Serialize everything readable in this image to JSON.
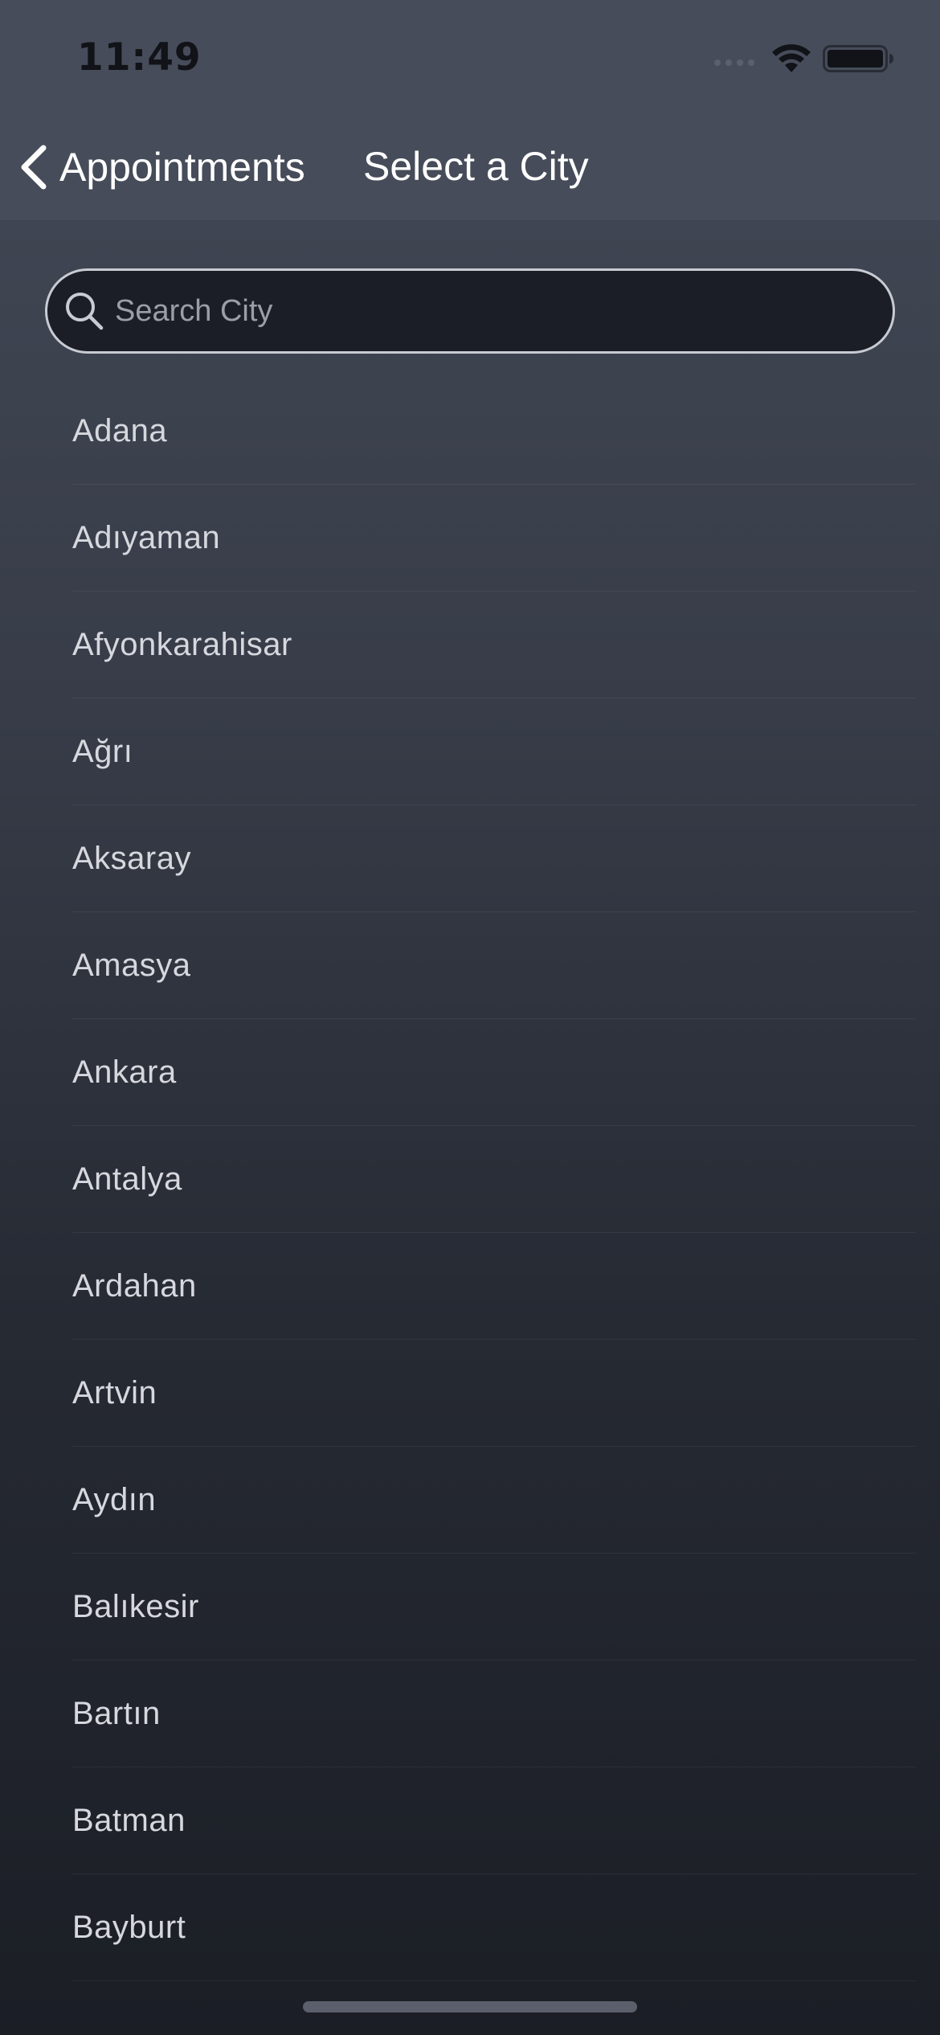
{
  "status_bar": {
    "time": "11:49",
    "icons": [
      "signal-icon",
      "wifi-icon",
      "battery-icon"
    ]
  },
  "nav": {
    "back_label": "Appointments",
    "title": "Select a City",
    "back_icon": "chevron-left-icon"
  },
  "search": {
    "placeholder": "Search City",
    "value": "",
    "icon": "search-icon"
  },
  "cities": [
    {
      "label": "Adana"
    },
    {
      "label": "Adıyaman"
    },
    {
      "label": "Afyonkarahisar"
    },
    {
      "label": "Ağrı"
    },
    {
      "label": "Aksaray"
    },
    {
      "label": "Amasya"
    },
    {
      "label": "Ankara"
    },
    {
      "label": "Antalya"
    },
    {
      "label": "Ardahan"
    },
    {
      "label": "Artvin"
    },
    {
      "label": "Aydın"
    },
    {
      "label": "Balıkesir"
    },
    {
      "label": "Bartın"
    },
    {
      "label": "Batman"
    },
    {
      "label": "Bayburt"
    }
  ],
  "colors": {
    "nav_background": "#464c59",
    "text_primary": "#ffffff",
    "list_text": "#d6d8de"
  }
}
